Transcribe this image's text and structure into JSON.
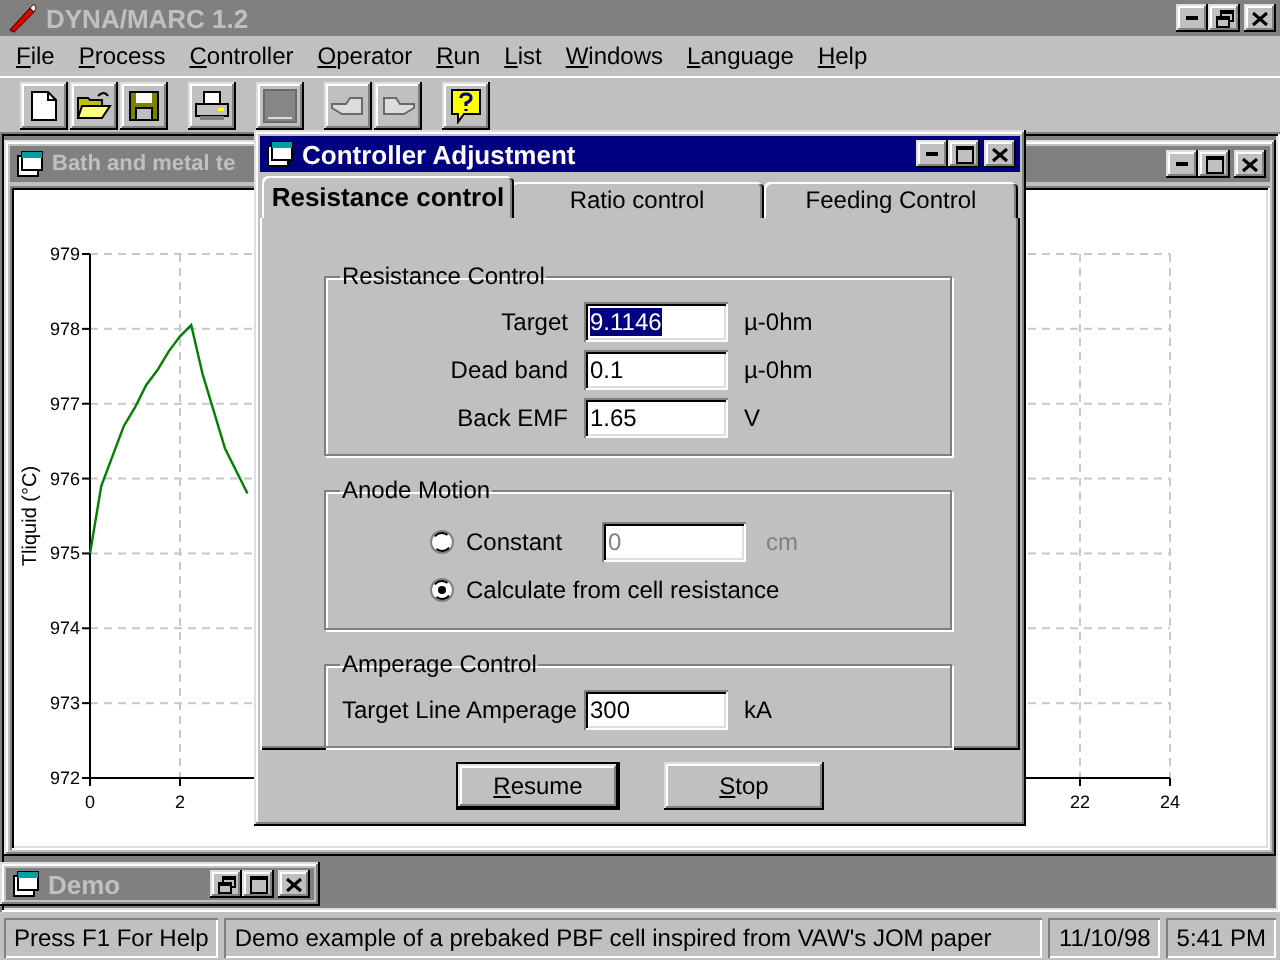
{
  "window": {
    "title": "DYNA/MARC 1.2",
    "active": false
  },
  "menu": [
    {
      "label": "File"
    },
    {
      "label": "Process"
    },
    {
      "label": "Controller"
    },
    {
      "label": "Operator"
    },
    {
      "label": "Run"
    },
    {
      "label": "List"
    },
    {
      "label": "Windows"
    },
    {
      "label": "Language"
    },
    {
      "label": "Help"
    }
  ],
  "toolbar": [
    {
      "kind": "new",
      "disabled": false
    },
    {
      "kind": "open",
      "disabled": false
    },
    {
      "kind": "save",
      "disabled": false
    },
    {
      "kind": "gap"
    },
    {
      "kind": "print",
      "disabled": false
    },
    {
      "kind": "gap"
    },
    {
      "kind": "blank",
      "disabled": true
    },
    {
      "kind": "gap"
    },
    {
      "kind": "hand-left",
      "disabled": true
    },
    {
      "kind": "hand-right",
      "disabled": true
    },
    {
      "kind": "gap"
    },
    {
      "kind": "help",
      "disabled": false
    }
  ],
  "chart_window": {
    "title": "Bath and metal te",
    "active": false,
    "chart_data": {
      "type": "line",
      "ylabel": "Tliquid (°C)",
      "grid": true,
      "xlim": [
        0,
        24
      ],
      "ylim": [
        972,
        979
      ],
      "xticks": [
        0,
        2,
        22,
        24
      ],
      "yticks": [
        972,
        973,
        974,
        975,
        976,
        977,
        978,
        979
      ],
      "series": [
        {
          "color": "#008000",
          "x": [
            0,
            0.25,
            0.5,
            0.75,
            1,
            1.25,
            1.5,
            1.75,
            2,
            2.25,
            2.5,
            2.75,
            3,
            3.25,
            3.5
          ],
          "values": [
            975,
            975.9,
            976.3,
            976.7,
            976.95,
            977.25,
            977.45,
            977.7,
            977.9,
            978.05,
            977.4,
            976.9,
            976.4,
            976.1,
            975.8
          ]
        }
      ]
    }
  },
  "dialog": {
    "title": "Controller Adjustment",
    "active": true,
    "tabs": [
      {
        "label": "Resistance control",
        "selected": true
      },
      {
        "label": "Ratio control",
        "selected": false
      },
      {
        "label": "Feeding Control",
        "selected": false
      }
    ],
    "resistance_control": {
      "title": "Resistance Control",
      "fields": [
        {
          "label": "Target",
          "value": "9.1146",
          "unit": "µ-0hm",
          "highlighted": true
        },
        {
          "label": "Dead band",
          "value": "0.1",
          "unit": "µ-0hm",
          "highlighted": false
        },
        {
          "label": "Back EMF",
          "value": "1.65",
          "unit": "V",
          "highlighted": false
        }
      ]
    },
    "anode_motion": {
      "title": "Anode Motion",
      "options": [
        {
          "label": "Constant",
          "selected": false,
          "value": "0",
          "unit": "cm",
          "disabled": true
        },
        {
          "label": "Calculate from cell resistance",
          "selected": true
        }
      ]
    },
    "amperage_control": {
      "title": "Amperage Control",
      "fields": [
        {
          "label": "Target Line Amperage",
          "value": "300",
          "unit": "kA",
          "highlighted": false
        }
      ]
    },
    "buttons": [
      {
        "label": "Resume",
        "default": true
      },
      {
        "label": "Stop",
        "default": false
      }
    ]
  },
  "minimized": [
    {
      "title": "Demo"
    }
  ],
  "status_bar": [
    "Press F1 For Help",
    "Demo example of a prebaked PBF cell inspired from VAW's JOM paper",
    "11/10/98",
    "5:41 PM"
  ]
}
